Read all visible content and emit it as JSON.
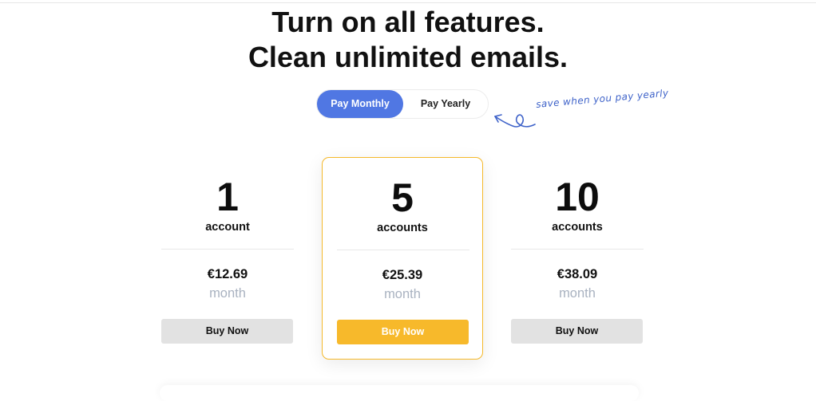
{
  "headline": {
    "line1": "Turn on all features.",
    "line2": "Clean unlimited emails."
  },
  "billing_toggle": {
    "monthly_label": "Pay Monthly",
    "yearly_label": "Pay Yearly",
    "selected": "monthly",
    "accent_color": "#5077e3"
  },
  "note": {
    "text": "save when you pay yearly",
    "icon": "curly-arrow-left-icon"
  },
  "plans": [
    {
      "count": "1",
      "unit": "account",
      "price": "€12.69",
      "period": "month",
      "button": "Buy Now",
      "highlighted": false
    },
    {
      "count": "5",
      "unit": "accounts",
      "price": "€25.39",
      "period": "month",
      "button": "Buy Now",
      "highlighted": true
    },
    {
      "count": "10",
      "unit": "accounts",
      "price": "€38.09",
      "period": "month",
      "button": "Buy Now",
      "highlighted": false
    }
  ],
  "colors": {
    "highlight": "#f7b92b",
    "button_default": "#e2e2e2",
    "muted_text": "#a9b2c0"
  }
}
